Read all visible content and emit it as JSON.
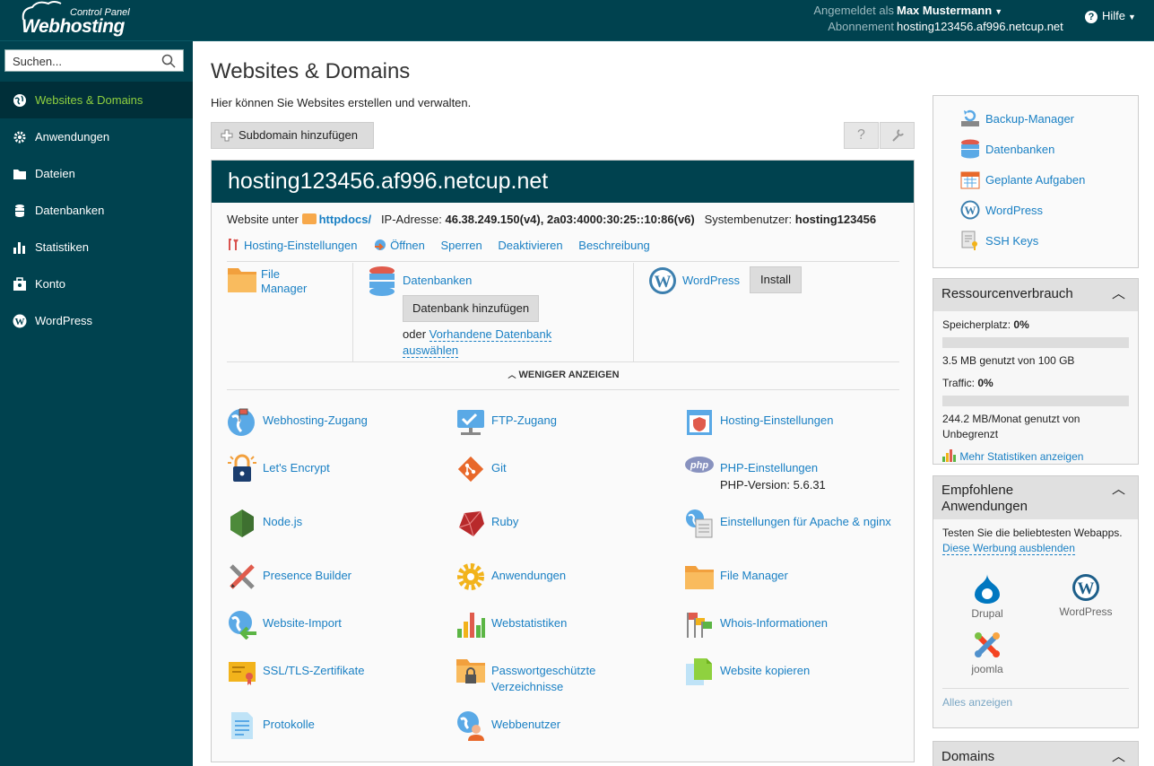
{
  "brand": {
    "line1": "Control Panel",
    "line2": "Webhosting"
  },
  "user": {
    "logged_label": "Angemeldet als",
    "name": "Max Mustermann",
    "sub_label": "Abonnement",
    "subscription": "hosting123456.af996.netcup.net"
  },
  "help_label": "Hilfe",
  "search": {
    "placeholder": "Suchen..."
  },
  "nav": [
    {
      "label": "Websites & Domains",
      "icon": "globe-icon",
      "active": true
    },
    {
      "label": "Anwendungen",
      "icon": "gear-icon"
    },
    {
      "label": "Dateien",
      "icon": "folder-icon"
    },
    {
      "label": "Datenbanken",
      "icon": "database-icon"
    },
    {
      "label": "Statistiken",
      "icon": "bar-chart-icon"
    },
    {
      "label": "Konto",
      "icon": "account-icon"
    },
    {
      "label": "WordPress",
      "icon": "wordpress-icon"
    }
  ],
  "page": {
    "title": "Websites & Domains",
    "intro": "Hier können Sie Websites erstellen und verwalten.",
    "add_subdomain": "Subdomain hinzufügen",
    "help_btn": "?",
    "settings_btn": "wrench-icon"
  },
  "domain": {
    "name": "hosting123456.af996.netcup.net",
    "website_under": "Website unter",
    "docroot": "httpdocs/",
    "ip_label": "IP-Adresse:",
    "ip": "46.38.249.150(v4), 2a03:4000:30:25::10:86(v6)",
    "sysuser_label": "Systembenutzer:",
    "sysuser": "hosting123456",
    "links": [
      "Hosting-Einstellungen",
      "Öffnen",
      "Sperren",
      "Deaktivieren",
      "Beschreibung"
    ],
    "file_manager": "File Manager",
    "databases": "Datenbanken",
    "add_db": "Datenbank hinzufügen",
    "or": "oder",
    "existing_db": "Vorhandene Datenbank auswählen",
    "wordpress": "WordPress",
    "install": "Install",
    "show_less": "WENIGER ANZEIGEN"
  },
  "tools": [
    {
      "label": "Webhosting-Zugang",
      "icon": "globe-flag-icon"
    },
    {
      "label": "FTP-Zugang",
      "icon": "ftp-icon"
    },
    {
      "label": "Hosting-Einstellungen",
      "icon": "hosting-settings-icon"
    },
    {
      "label": "Let's Encrypt",
      "icon": "lock-icon"
    },
    {
      "label": "Git",
      "icon": "git-icon"
    },
    {
      "label": "PHP-Einstellungen",
      "sub": "PHP-Version: 5.6.31",
      "icon": "php-icon"
    },
    {
      "label": "Node.js",
      "icon": "nodejs-icon"
    },
    {
      "label": "Ruby",
      "icon": "ruby-icon"
    },
    {
      "label": "Einstellungen für Apache & nginx",
      "icon": "apache-icon"
    },
    {
      "label": "Presence Builder",
      "icon": "tools-icon"
    },
    {
      "label": "Anwendungen",
      "icon": "gear-icon"
    },
    {
      "label": "File Manager",
      "icon": "folder-icon"
    },
    {
      "label": "Website-Import",
      "icon": "import-icon"
    },
    {
      "label": "Webstatistiken",
      "icon": "bar-chart-icon"
    },
    {
      "label": "Whois-Informationen",
      "icon": "whois-icon"
    },
    {
      "label": "SSL/TLS-Zertifikate",
      "icon": "certificate-icon"
    },
    {
      "label": "Passwortgeschützte Verzeichnisse",
      "icon": "protected-folder-icon"
    },
    {
      "label": "Website kopieren",
      "icon": "copy-icon"
    },
    {
      "label": "Protokolle",
      "icon": "log-icon"
    },
    {
      "label": "Webbenutzer",
      "icon": "web-user-icon"
    }
  ],
  "right": {
    "links": [
      {
        "label": "Backup-Manager",
        "icon": "backup-icon"
      },
      {
        "label": "Datenbanken",
        "icon": "database-icon"
      },
      {
        "label": "Geplante Aufgaben",
        "icon": "calendar-icon"
      },
      {
        "label": "WordPress",
        "icon": "wordpress-icon"
      },
      {
        "label": "SSH Keys",
        "icon": "ssh-key-icon"
      }
    ],
    "resources": {
      "title": "Ressourcenverbrauch",
      "storage_label": "Speicherplatz:",
      "storage_pct": "0%",
      "storage_fraction": 0,
      "storage_text": "3.5 MB genutzt von 100 GB",
      "traffic_label": "Traffic:",
      "traffic_pct": "0%",
      "traffic_fraction": 0,
      "traffic_text": "244.2 MB/Monat genutzt von Unbegrenzt",
      "more_stats": "Mehr Statistiken anzeigen"
    },
    "apps": {
      "title": "Empfohlene Anwendungen",
      "text": "Testen Sie die beliebtesten Webapps.",
      "hide_ad": "Diese Werbung ausblenden",
      "items": [
        {
          "label": "Drupal",
          "icon": "drupal-icon"
        },
        {
          "label": "WordPress",
          "icon": "wordpress-icon"
        },
        {
          "label": "joomla",
          "icon": "joomla-icon"
        }
      ],
      "show_all": "Alles anzeigen"
    },
    "domains_title": "Domains"
  },
  "colors": {
    "header": "#00424f",
    "link": "#1a80c4",
    "active_nav": "#8fd13f"
  }
}
